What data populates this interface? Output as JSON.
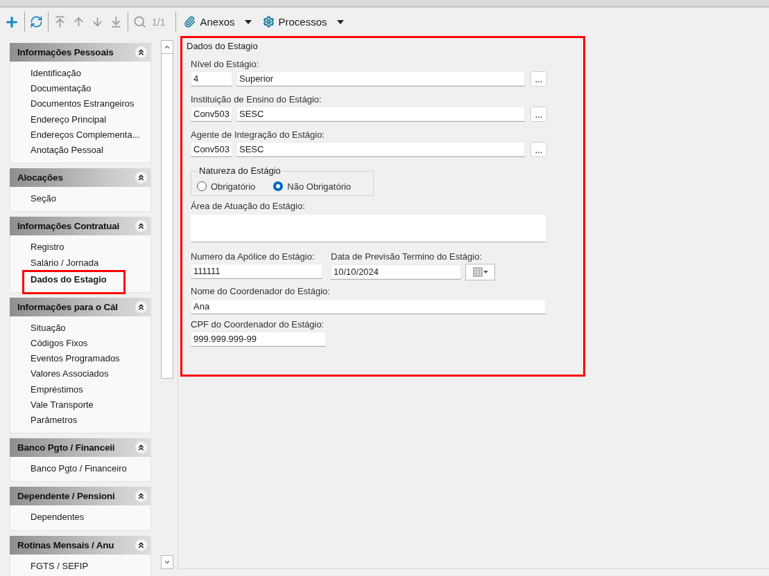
{
  "toolbar": {
    "tools": [
      {
        "kind": "add",
        "disabled": false,
        "separator_after": true
      },
      {
        "kind": "refresh",
        "disabled": false,
        "separator_after": true
      },
      {
        "kind": "first",
        "disabled": true,
        "separator_after": false
      },
      {
        "kind": "previous",
        "disabled": true,
        "separator_after": false
      },
      {
        "kind": "next",
        "disabled": true,
        "separator_after": false
      },
      {
        "kind": "last",
        "disabled": true,
        "separator_after": true
      },
      {
        "kind": "search",
        "disabled": true,
        "separator_after": false
      }
    ],
    "pager": "1/1",
    "menus": [
      {
        "kind": "attachments",
        "label": "Anexos"
      },
      {
        "kind": "processes",
        "label": "Processos"
      }
    ]
  },
  "sidebar": {
    "sections": [
      {
        "title": "Informações Pessoais",
        "expanded": true,
        "items": [
          {
            "label": "Identificação",
            "selected": false,
            "highlighted": false
          },
          {
            "label": "Documentação",
            "selected": false,
            "highlighted": false
          },
          {
            "label": "Documentos Estrangeiros",
            "selected": false,
            "highlighted": false
          },
          {
            "label": "Endereço Principal",
            "selected": false,
            "highlighted": false
          },
          {
            "label": "Endereços Complementa...",
            "selected": false,
            "highlighted": false
          },
          {
            "label": "Anotação Pessoal",
            "selected": false,
            "highlighted": false
          }
        ]
      },
      {
        "title": "Alocações",
        "expanded": true,
        "items": [
          {
            "label": "Seção",
            "selected": false,
            "highlighted": false
          }
        ]
      },
      {
        "title": "Informações Contratuai",
        "expanded": true,
        "items": [
          {
            "label": "Registro",
            "selected": false,
            "highlighted": false
          },
          {
            "label": "Salário / Jornada",
            "selected": false,
            "highlighted": false
          },
          {
            "label": "Dados do Estagio",
            "selected": true,
            "highlighted": true
          }
        ]
      },
      {
        "title": "Informações para o Cál",
        "expanded": true,
        "items": [
          {
            "label": "Situação",
            "selected": false,
            "highlighted": false
          },
          {
            "label": "Códigos Fixos",
            "selected": false,
            "highlighted": false
          },
          {
            "label": "Eventos Programados",
            "selected": false,
            "highlighted": false
          },
          {
            "label": "Valores Associados",
            "selected": false,
            "highlighted": false
          },
          {
            "label": "Empréstimos",
            "selected": false,
            "highlighted": false
          },
          {
            "label": "Vale Transporte",
            "selected": false,
            "highlighted": false
          },
          {
            "label": "Parâmetros",
            "selected": false,
            "highlighted": false
          }
        ]
      },
      {
        "title": "Banco Pgto / Financeii",
        "expanded": true,
        "items": [
          {
            "label": "Banco Pgto / Financeiro",
            "selected": false,
            "highlighted": false
          }
        ]
      },
      {
        "title": "Dependente / Pensioni",
        "expanded": true,
        "items": [
          {
            "label": "Dependentes",
            "selected": false,
            "highlighted": false
          }
        ]
      },
      {
        "title": "Rotinas Mensais / Anu",
        "expanded": true,
        "items": [
          {
            "label": "FGTS / SEFIP",
            "selected": false,
            "highlighted": false
          }
        ]
      }
    ]
  },
  "form": {
    "title": "Dados do Estagio",
    "highlighted": true,
    "lookups": [
      {
        "label": "Nível do Estágio:",
        "code": "4",
        "value": "Superior",
        "button": "..."
      },
      {
        "label": "Instituição de Ensino do Estágio:",
        "code": "Conv503",
        "value": "SESC",
        "button": "..."
      },
      {
        "label": "Agente de Integração do Estágio:",
        "code": "Conv503",
        "value": "SESC",
        "button": "..."
      }
    ],
    "nature": {
      "title": "Natureza do Estágio",
      "options": [
        {
          "label": "Obrigatório",
          "selected": false
        },
        {
          "label": "Não Obrigatório",
          "selected": true
        }
      ]
    },
    "area": {
      "label": "Área de Atuação do Estágio:"
    },
    "policy": {
      "label": "Numero da Apólice do Estágio:",
      "value": "111111"
    },
    "end_date": {
      "label": "Data de Previsão Termino do Estágio:",
      "value": "10/10/2024"
    },
    "coordinator_name": {
      "label": "Nome do Coordenador do Estágio:",
      "value": "Ana"
    },
    "coordinator_cpf": {
      "label": "CPF do Coordenador do Estágio:",
      "value": "999.999.999-99"
    }
  }
}
